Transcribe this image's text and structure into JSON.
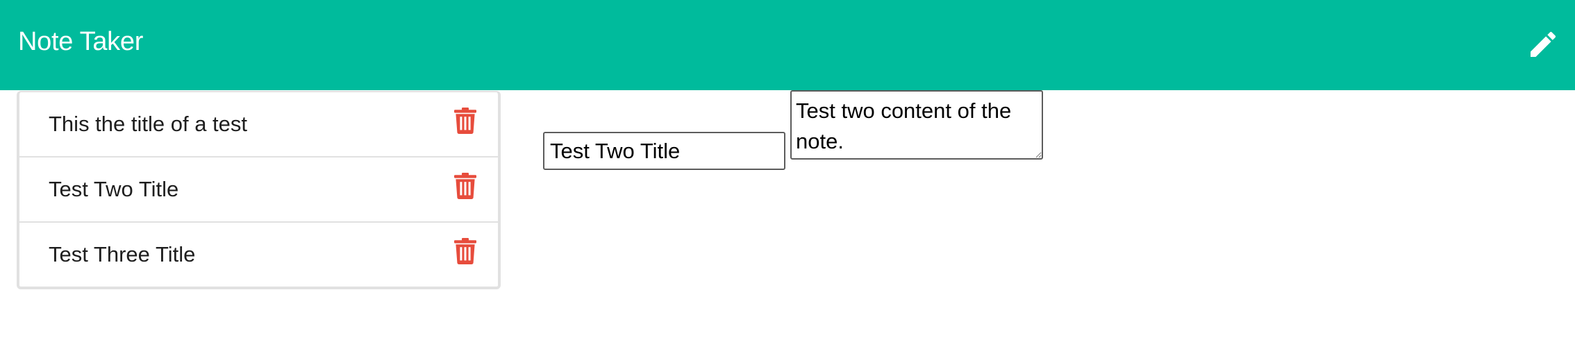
{
  "app": {
    "title": "Note Taker",
    "icons": {
      "edit": "pencil-icon",
      "delete": "trash-icon"
    },
    "colors": {
      "navbar": "#00bb9c",
      "delete_icon": "#e74c3c",
      "list_border": "#e1e1e1"
    }
  },
  "notes": [
    {
      "title": "This the title of a test"
    },
    {
      "title": "Test Two Title"
    },
    {
      "title": "Test Three Title"
    }
  ],
  "editor": {
    "title_value": "Test Two Title",
    "content_value": "Test two content of the note."
  }
}
